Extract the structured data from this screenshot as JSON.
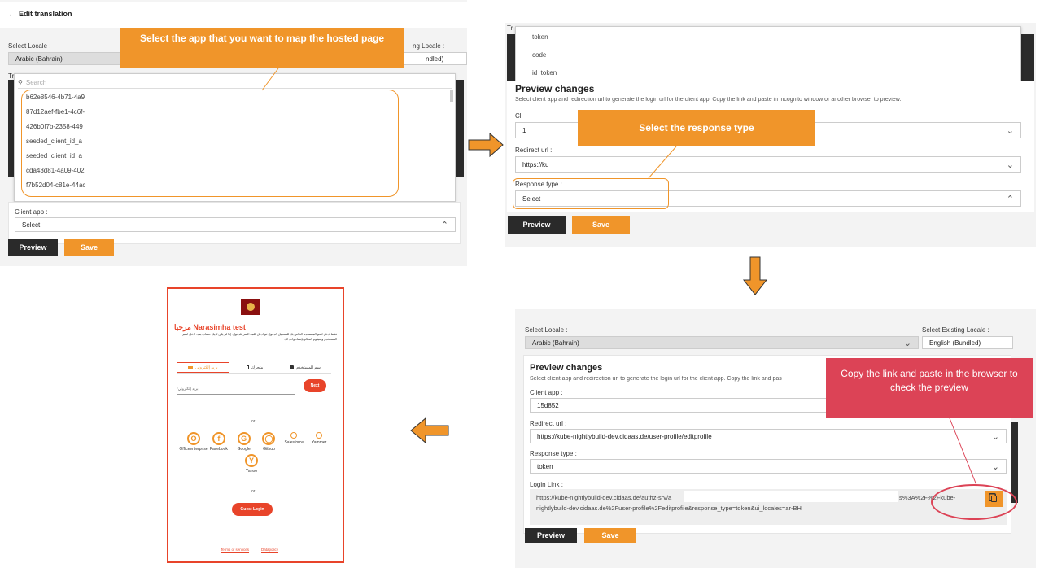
{
  "panel1": {
    "back_label": "Edit translation",
    "select_locale_label": "Select Locale :",
    "select_locale_value": "Arabic (Bahrain)",
    "existing_locale_label_partial": "ng Locale :",
    "existing_locale_value_partial": "ndled)",
    "translation_label_partial": "Tr",
    "search_placeholder": "Search",
    "dropdown_items": [
      "b62e8546-4b71-4a9",
      "87d12aef-fbe1-4c6f-",
      "426b0f7b-2358-449",
      "seeded_client_id_a",
      "seeded_client_id_a",
      "cda43d81-4a09-402",
      "f7b52d04-c81e-44ac"
    ],
    "client_app_label": "Client app :",
    "client_app_value": "Select",
    "preview_label": "Preview",
    "save_label": "Save",
    "callout": "Select the app that you want to map the hosted page"
  },
  "panel2": {
    "translation_label_partial": "Tr",
    "dropdown_items": [
      "token",
      "code",
      "id_token"
    ],
    "preview_title": "Preview changes",
    "preview_desc": "Select client app and redirection url to generate the login url for the client app. Copy the link and paste in incognito window or another browser to preview.",
    "client_label_partial": "Cli",
    "client_value_partial": "1",
    "redirect_label": "Redirect url :",
    "redirect_value": "https://ku",
    "response_label": "Response type :",
    "response_value": "Select",
    "preview_label": "Preview",
    "save_label": "Save",
    "callout": "Select the response type"
  },
  "panel3": {
    "select_locale_label": "Select Locale :",
    "select_locale_value": "Arabic (Bahrain)",
    "existing_locale_label": "Select Existing Locale :",
    "existing_locale_value": "English (Bundled)",
    "preview_title": "Preview changes",
    "preview_desc": "Select client app and redirection url to generate the login url for the client app. Copy the link and pas",
    "client_label": "Client app :",
    "client_value": "15d852",
    "redirect_label": "Redirect url :",
    "redirect_value": "https://kube-nightlybuild-dev.cidaas.de/user-profile/editprofile",
    "response_label": "Response type :",
    "response_value": "token",
    "login_link_label": "Login Link :",
    "login_link_line1_a": "https://kube-nightlybuild-dev.cidaas.de/authz-srv/a",
    "login_link_line1_b": "s%3A%2F%2Fkube-",
    "login_link_line2": "nightlybuild-dev.cidaas.de%2Fuser-profile%2Feditprofile&response_type=token&ui_locales=ar-BH",
    "preview_label": "Preview",
    "save_label": "Save",
    "callout": "Copy the link and paste in the browser to check the preview"
  },
  "panel4": {
    "greeting": "مرحبا Narasimha test",
    "intro": "فقط أدخل اسم المستخدم الخاص بك للتسجيل الدخول ثم ادخل كلمة السر للدخول. إذا لم يكن لديك حساب بعد، أدخل اسم المستخدم وسيقوم النظام بإنشاء واحد لك",
    "tab_email": "بريد إلكتروني",
    "tab_mobile": "متحرك",
    "tab_username": "اسم المستخدم",
    "email_placeholder": "*بريد إلكتروني",
    "next_label": "Next",
    "or_label": "or",
    "providers": [
      "Officeenterprise",
      "Facebook",
      "Google",
      "Github",
      "Salesforce",
      "Yammer",
      "Yahoo"
    ],
    "guest_login": "Guest Login",
    "terms_label": "Terms of services",
    "policy_label": "Datapolicy"
  },
  "colors": {
    "accent": "#f0952a",
    "callout_red": "#dc4356",
    "frame_red": "#e8442a"
  }
}
